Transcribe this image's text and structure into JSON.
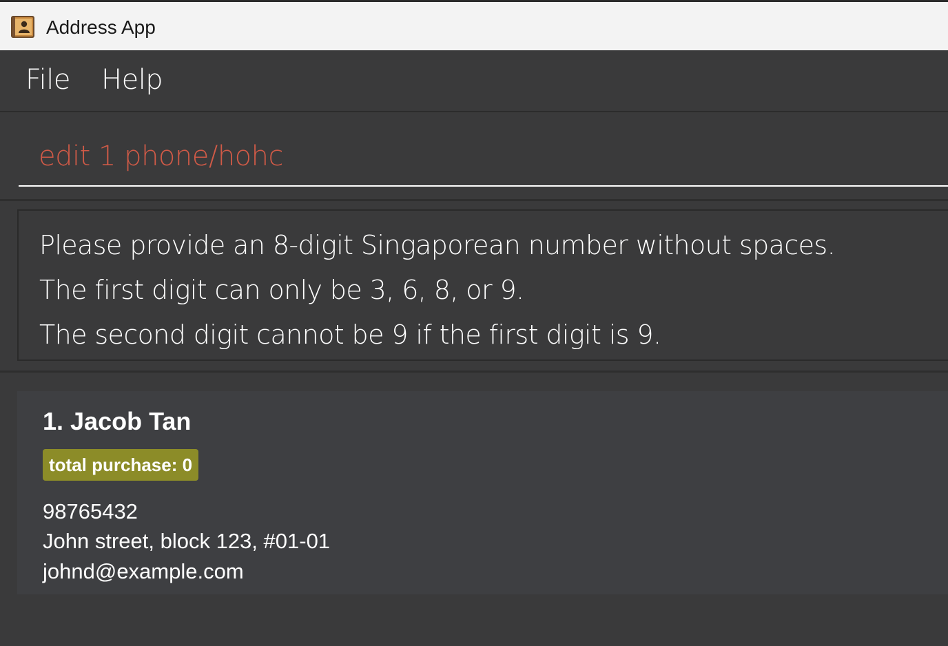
{
  "window": {
    "title": "Address App"
  },
  "menu": {
    "items": [
      {
        "label": "File"
      },
      {
        "label": "Help"
      }
    ]
  },
  "command": {
    "value": "edit 1 phone/hohc",
    "text_color": "#d05a47"
  },
  "result": {
    "lines": [
      "Please provide an 8-digit Singaporean number without spaces.",
      "The first digit can only be 3, 6, 8, or 9.",
      "The second digit cannot be 9 if the first digit is 9."
    ]
  },
  "persons": [
    {
      "index_name": "1. Jacob Tan",
      "tag": "total purchase: 0",
      "tag_color": "#8c8c28",
      "phone": "98765432",
      "address": "John street, block 123, #01-01",
      "email": "johnd@example.com"
    }
  ],
  "icons": {
    "app": "address-book-icon"
  }
}
